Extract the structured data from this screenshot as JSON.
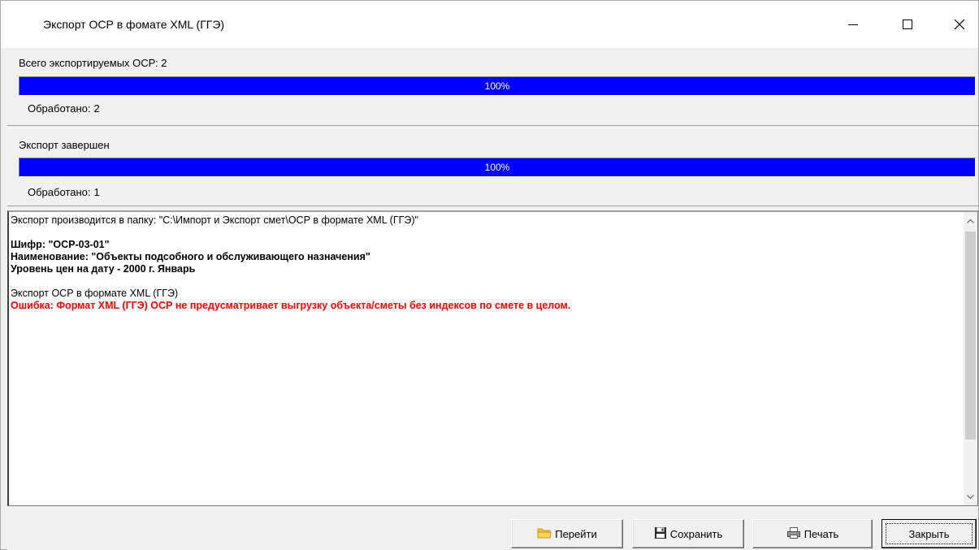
{
  "window": {
    "title": "Экспорт ОСР в фомате XML (ГГЭ)"
  },
  "total_panel": {
    "label": "Всего экспортируемых ОСР: 2",
    "progress": 1.0,
    "progress_text": "100%",
    "processed_label": "Обработано:",
    "processed_value": "2"
  },
  "current_panel": {
    "label": "Экспорт завершен",
    "progress": 1.0,
    "progress_text": "100%",
    "processed_label": "Обработано:",
    "processed_value": "1"
  },
  "log": {
    "lines": [
      {
        "text": "Экспорт производится в папку: \"C:\\Импорт и Экспорт смет\\ОСР в формате XML (ГГЭ)\"",
        "style": "normal"
      },
      {
        "text": "",
        "style": "spacer"
      },
      {
        "text": "Шифр: \"ОСР-03-01\"",
        "style": "bold"
      },
      {
        "text": "Наименование: \"Объекты подсобного и обслуживающего назначения\"",
        "style": "bold"
      },
      {
        "text": "Уровень цен на дату - 2000 г. Январь",
        "style": "bold"
      },
      {
        "text": "",
        "style": "spacer"
      },
      {
        "text": "Экспорт ОСР в формате XML (ГГЭ)",
        "style": "normal"
      },
      {
        "text": "Ошибка: Формат XML (ГГЭ) ОСР не предусматривает выгрузку объекта/сметы без индексов по смете в целом.",
        "style": "error"
      }
    ]
  },
  "buttons": {
    "goto": "Перейти",
    "save": "Сохранить",
    "print": "Печать",
    "close": "Закрыть"
  },
  "colors": {
    "progress_fill": "#0000ff",
    "error_text": "#ff0000"
  },
  "icons": {
    "goto": "folder-icon",
    "save": "floppy-disk-icon",
    "print": "printer-icon"
  }
}
